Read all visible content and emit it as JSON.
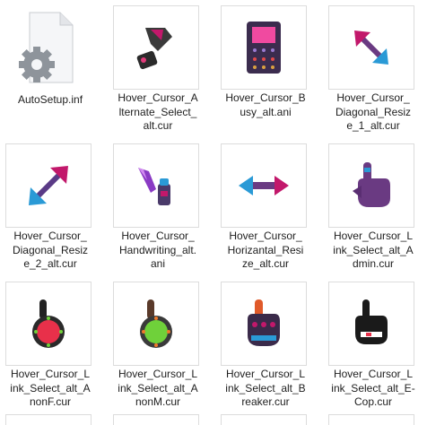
{
  "files": [
    {
      "name": "AutoSetup.inf",
      "label": "AutoSetup.inf",
      "icon": "settings-file-icon"
    },
    {
      "name": "Hover_Cursor_Alternate_Select_alt.cur",
      "label": "Hover_Cursor_A\nlternate_Select_\nalt.cur",
      "icon": "alternate-select-cursor-icon"
    },
    {
      "name": "Hover_Cursor_Busy_alt.ani",
      "label": "Hover_Cursor_B\nusy_alt.ani",
      "icon": "busy-cursor-icon"
    },
    {
      "name": "Hover_Cursor_Diagonal_Resize_1_alt.cur",
      "label": "Hover_Cursor_\nDiagonal_Resiz\ne_1_alt.cur",
      "icon": "diagonal-resize-1-cursor-icon"
    },
    {
      "name": "Hover_Cursor_Diagonal_Resize_2_alt.cur",
      "label": "Hover_Cursor_\nDiagonal_Resiz\ne_2_alt.cur",
      "icon": "diagonal-resize-2-cursor-icon"
    },
    {
      "name": "Hover_Cursor_Handwriting_alt.ani",
      "label": "Hover_Cursor_\nHandwriting_alt.\nani",
      "icon": "handwriting-cursor-icon"
    },
    {
      "name": "Hover_Cursor_Horizantal_Resize_alt.cur",
      "label": "Hover_Cursor_\nHorizantal_Resi\nze_alt.cur",
      "icon": "horizontal-resize-cursor-icon"
    },
    {
      "name": "Hover_Cursor_Link_Select_alt_Admin.cur",
      "label": "Hover_Cursor_L\nink_Select_alt_A\ndmin.cur",
      "icon": "link-select-admin-cursor-icon"
    },
    {
      "name": "Hover_Cursor_Link_Select_alt_AnonF.cur",
      "label": "Hover_Cursor_L\nink_Select_alt_A\nnonF.cur",
      "icon": "link-select-anonf-cursor-icon"
    },
    {
      "name": "Hover_Cursor_Link_Select_alt_AnonM.cur",
      "label": "Hover_Cursor_L\nink_Select_alt_A\nnonM.cur",
      "icon": "link-select-anonm-cursor-icon"
    },
    {
      "name": "Hover_Cursor_Link_Select_alt_Breaker.cur",
      "label": "Hover_Cursor_L\nink_Select_alt_B\nreaker.cur",
      "icon": "link-select-breaker-cursor-icon"
    },
    {
      "name": "Hover_Cursor_Link_Select_alt_E-Cop.cur",
      "label": "Hover_Cursor_L\nink_Select_alt_E-\nCop.cur",
      "icon": "link-select-ecop-cursor-icon"
    }
  ],
  "colors": {
    "label_text": "#1e1e1e",
    "thumb_border": "#dcdcdc",
    "cursor_blue": "#2a9ad6",
    "cursor_magenta": "#c2186b",
    "cursor_purple": "#6a3a82",
    "busy_pink": "#f04aa0",
    "anonf_red": "#e8304a",
    "anonm_green": "#6fd13a"
  }
}
